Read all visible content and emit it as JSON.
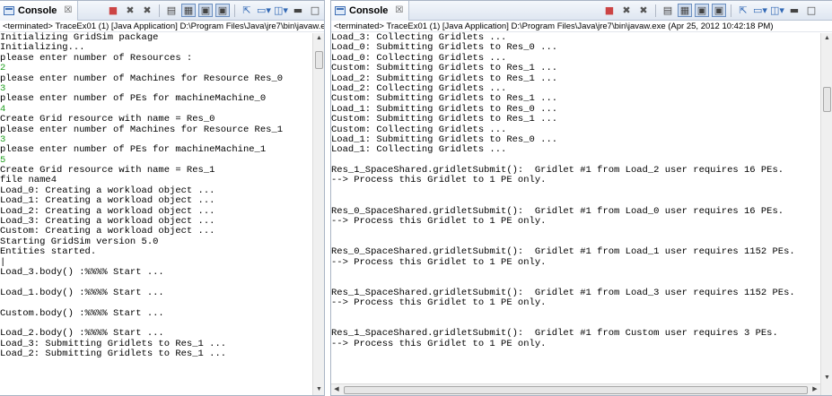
{
  "left": {
    "tab_label": "Console",
    "tab_close": "☒",
    "status": "<terminated> TraceEx01 (1) [Java Application] D:\\Program Files\\Java\\jre7\\bin\\javaw.exe",
    "lines": [
      {
        "text": "Initializing GridSim package",
        "type": "out"
      },
      {
        "text": "Initializing...",
        "type": "out"
      },
      {
        "text": "please enter number of Resources :",
        "type": "out"
      },
      {
        "text": "2",
        "type": "in"
      },
      {
        "text": "please enter number of Machines for Resource Res_0",
        "type": "out"
      },
      {
        "text": "3",
        "type": "in"
      },
      {
        "text": "please enter number of PEs for machineMachine_0",
        "type": "out"
      },
      {
        "text": "4",
        "type": "in"
      },
      {
        "text": "Create Grid resource with name = Res_0",
        "type": "out"
      },
      {
        "text": "please enter number of Machines for Resource Res_1",
        "type": "out"
      },
      {
        "text": "3",
        "type": "in"
      },
      {
        "text": "please enter number of PEs for machineMachine_1",
        "type": "out"
      },
      {
        "text": "5",
        "type": "in"
      },
      {
        "text": "Create Grid resource with name = Res_1",
        "type": "out"
      },
      {
        "text": "file name4",
        "type": "out"
      },
      {
        "text": "Load_0: Creating a workload object ...",
        "type": "out"
      },
      {
        "text": "Load_1: Creating a workload object ...",
        "type": "out"
      },
      {
        "text": "Load_2: Creating a workload object ...",
        "type": "out"
      },
      {
        "text": "Load_3: Creating a workload object ...",
        "type": "out"
      },
      {
        "text": "Custom: Creating a workload object ...",
        "type": "out"
      },
      {
        "text": "Starting GridSim version 5.0",
        "type": "out"
      },
      {
        "text": "Entities started.",
        "type": "out"
      },
      {
        "text": "|",
        "type": "out"
      },
      {
        "text": "Load_3.body() :%%%% Start ...",
        "type": "out"
      },
      {
        "text": "",
        "type": "out"
      },
      {
        "text": "Load_1.body() :%%%% Start ...",
        "type": "out"
      },
      {
        "text": "",
        "type": "out"
      },
      {
        "text": "Custom.body() :%%%% Start ...",
        "type": "out"
      },
      {
        "text": "",
        "type": "out"
      },
      {
        "text": "Load_2.body() :%%%% Start ...",
        "type": "out"
      },
      {
        "text": "Load_3: Submitting Gridlets to Res_1 ...",
        "type": "out"
      },
      {
        "text": "Load_2: Submitting Gridlets to Res_1 ...",
        "type": "out"
      }
    ]
  },
  "right": {
    "tab_label": "Console",
    "tab_close": "☒",
    "status": "<terminated> TraceEx01 (1) [Java Application] D:\\Program Files\\Java\\jre7\\bin\\javaw.exe (Apr 25, 2012 10:42:18 PM)",
    "lines": [
      {
        "text": "Load_3: Collecting Gridlets ...",
        "type": "out"
      },
      {
        "text": "Load_0: Submitting Gridlets to Res_0 ...",
        "type": "out"
      },
      {
        "text": "Load_0: Collecting Gridlets ...",
        "type": "out"
      },
      {
        "text": "Custom: Submitting Gridlets to Res_1 ...",
        "type": "out"
      },
      {
        "text": "Load_2: Submitting Gridlets to Res_1 ...",
        "type": "out"
      },
      {
        "text": "Load_2: Collecting Gridlets ...",
        "type": "out"
      },
      {
        "text": "Custom: Submitting Gridlets to Res_1 ...",
        "type": "out"
      },
      {
        "text": "Load_1: Submitting Gridlets to Res_0 ...",
        "type": "out"
      },
      {
        "text": "Custom: Submitting Gridlets to Res_1 ...",
        "type": "out"
      },
      {
        "text": "Custom: Collecting Gridlets ...",
        "type": "out"
      },
      {
        "text": "Load_1: Submitting Gridlets to Res_0 ...",
        "type": "out"
      },
      {
        "text": "Load_1: Collecting Gridlets ...",
        "type": "out"
      },
      {
        "text": "",
        "type": "out"
      },
      {
        "text": "Res_1_SpaceShared.gridletSubmit():  Gridlet #1 from Load_2 user requires 16 PEs.",
        "type": "out"
      },
      {
        "text": "--> Process this Gridlet to 1 PE only.",
        "type": "out"
      },
      {
        "text": "",
        "type": "out"
      },
      {
        "text": "",
        "type": "out"
      },
      {
        "text": "Res_0_SpaceShared.gridletSubmit():  Gridlet #1 from Load_0 user requires 16 PEs.",
        "type": "out"
      },
      {
        "text": "--> Process this Gridlet to 1 PE only.",
        "type": "out"
      },
      {
        "text": "",
        "type": "out"
      },
      {
        "text": "",
        "type": "out"
      },
      {
        "text": "Res_0_SpaceShared.gridletSubmit():  Gridlet #1 from Load_1 user requires 1152 PEs.",
        "type": "out"
      },
      {
        "text": "--> Process this Gridlet to 1 PE only.",
        "type": "out"
      },
      {
        "text": "",
        "type": "out"
      },
      {
        "text": "",
        "type": "out"
      },
      {
        "text": "Res_1_SpaceShared.gridletSubmit():  Gridlet #1 from Load_3 user requires 1152 PEs.",
        "type": "out"
      },
      {
        "text": "--> Process this Gridlet to 1 PE only.",
        "type": "out"
      },
      {
        "text": "",
        "type": "out"
      },
      {
        "text": "",
        "type": "out"
      },
      {
        "text": "Res_1_SpaceShared.gridletSubmit():  Gridlet #1 from Custom user requires 3 PEs.",
        "type": "out"
      },
      {
        "text": "--> Process this Gridlet to 1 PE only.",
        "type": "out"
      }
    ]
  },
  "toolbar_icons": [
    "terminate-icon",
    "remove-launch-icon",
    "remove-all-icon",
    "clear-console-icon",
    "scroll-lock-icon",
    "show-stdout-icon",
    "show-stderr-icon",
    "pin-console-icon",
    "display-console-icon",
    "open-console-icon",
    "minimize-icon",
    "maximize-icon"
  ],
  "colors": {
    "stdin_text": "#22a022",
    "stdout_text": "#000000",
    "tab_border": "#a9b4c4"
  }
}
